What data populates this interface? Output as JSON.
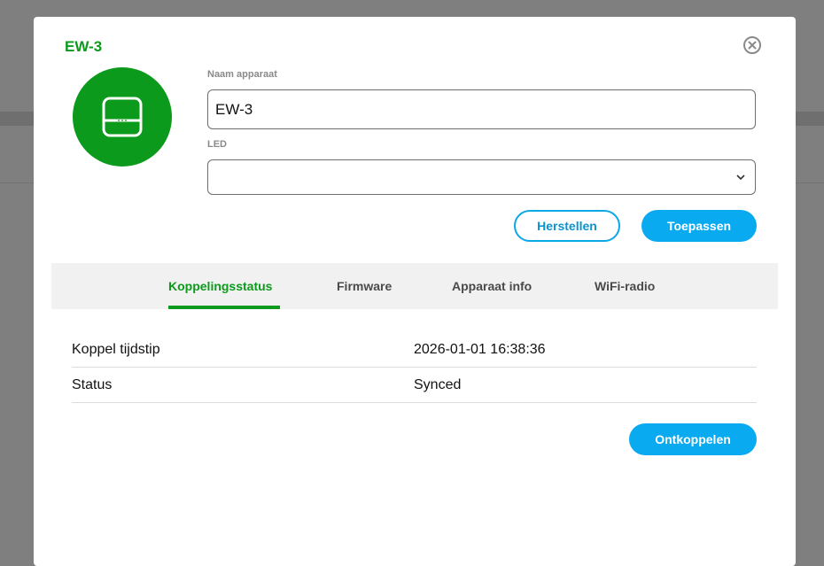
{
  "dialog": {
    "title": "EW-3",
    "device_icon": "extender-device-icon",
    "close_icon": "close-circle-icon"
  },
  "form": {
    "name_label": "Naam apparaat",
    "name_value": "EW-3",
    "led_label": "LED",
    "led_value": ""
  },
  "actions": {
    "reset_label": "Herstellen",
    "apply_label": "Toepassen"
  },
  "tabs": [
    {
      "label": "Koppelingsstatus",
      "active": true
    },
    {
      "label": "Firmware",
      "active": false
    },
    {
      "label": "Apparaat info",
      "active": false
    },
    {
      "label": "WiFi-radio",
      "active": false
    }
  ],
  "status_rows": [
    {
      "key": "Koppel tijdstip",
      "value": "2026-01-01 16:38:36"
    },
    {
      "key": "Status",
      "value": "Synced"
    }
  ],
  "footer": {
    "unpair_label": "Ontkoppelen"
  },
  "colors": {
    "brand_green": "#0b9a1b",
    "accent_blue": "#0aaaf0"
  }
}
